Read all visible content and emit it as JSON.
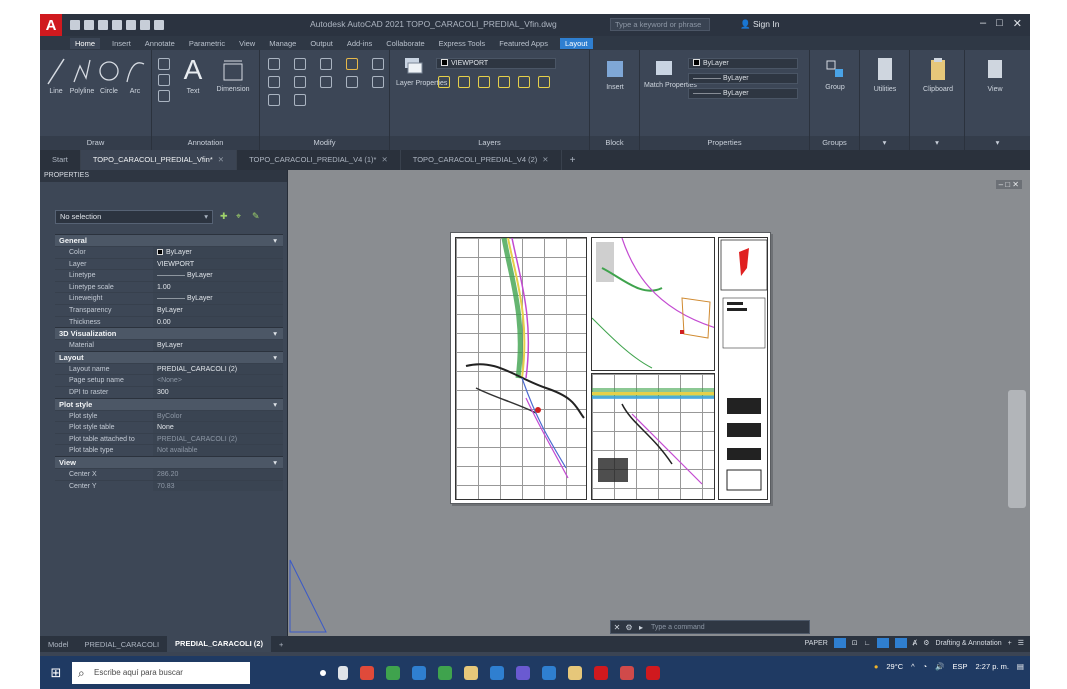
{
  "title_bar": {
    "app_letter": "A",
    "title": "Autodesk AutoCAD 2021  TOPO_CARACOLI_PREDIAL_Vfin.dwg",
    "search_placeholder": "Type a keyword or phrase",
    "signin": "Sign In"
  },
  "ribbon_tabs": [
    "Home",
    "Insert",
    "Annotate",
    "Parametric",
    "View",
    "Manage",
    "Output",
    "Add-ins",
    "Collaborate",
    "Express Tools",
    "Featured Apps",
    "Layout"
  ],
  "ribbon": {
    "draw": {
      "title": "Draw",
      "line": "Line",
      "polyline": "Polyline",
      "circle": "Circle",
      "arc": "Arc"
    },
    "annotation": {
      "title": "Annotation",
      "text": "Text",
      "dimension": "Dimension"
    },
    "modify": {
      "title": "Modify"
    },
    "layers": {
      "title": "Layers",
      "layer_properties": "Layer Properties",
      "current_layer": "VIEWPORT"
    },
    "block": {
      "title": "Block",
      "insert": "Insert"
    },
    "properties": {
      "title": "Properties",
      "match": "Match Properties",
      "bylayer_1": "ByLayer",
      "bylayer_2": "ByLayer",
      "bylayer_3": "ByLayer"
    },
    "groups": {
      "title": "Groups",
      "group": "Group"
    },
    "utilities": "Utilities",
    "clipboard": "Clipboard",
    "view": "View"
  },
  "file_tabs": [
    {
      "label": "Start",
      "active": false
    },
    {
      "label": "TOPO_CARACOLI_PREDIAL_Vfin*",
      "active": true
    },
    {
      "label": "TOPO_CARACOLI_PREDIAL_V4 (1)*",
      "active": false
    },
    {
      "label": "TOPO_CARACOLI_PREDIAL_V4 (2)",
      "active": false
    }
  ],
  "properties_palette": {
    "title": "PROPERTIES",
    "selection": "No selection",
    "sections": [
      {
        "name": "General",
        "rows": [
          {
            "k": "Color",
            "v": "ByLayer"
          },
          {
            "k": "Layer",
            "v": "VIEWPORT"
          },
          {
            "k": "Linetype",
            "v": "———— ByLayer"
          },
          {
            "k": "Linetype scale",
            "v": "1.00"
          },
          {
            "k": "Lineweight",
            "v": "———— ByLayer"
          },
          {
            "k": "Transparency",
            "v": "ByLayer"
          },
          {
            "k": "Thickness",
            "v": "0.00"
          }
        ]
      },
      {
        "name": "3D Visualization",
        "rows": [
          {
            "k": "Material",
            "v": "ByLayer"
          }
        ]
      },
      {
        "name": "Layout",
        "rows": [
          {
            "k": "Layout name",
            "v": "PREDIAL_CARACOLI (2)"
          },
          {
            "k": "Page setup name",
            "v": "<None>"
          },
          {
            "k": "DPI to raster",
            "v": "300"
          }
        ]
      },
      {
        "name": "Plot style",
        "rows": [
          {
            "k": "Plot style",
            "v": "ByColor"
          },
          {
            "k": "Plot style table",
            "v": "None"
          },
          {
            "k": "Plot table attached to",
            "v": "PREDIAL_CARACOLI (2)"
          },
          {
            "k": "Plot table type",
            "v": "Not available"
          }
        ]
      },
      {
        "name": "View",
        "rows": [
          {
            "k": "Center X",
            "v": "286.20"
          },
          {
            "k": "Center Y",
            "v": "70.83"
          }
        ]
      }
    ]
  },
  "command_line": {
    "placeholder": "Type a command"
  },
  "layout_tabs": [
    {
      "label": "Model",
      "active": false
    },
    {
      "label": "PREDIAL_CARACOLI",
      "active": false
    },
    {
      "label": "PREDIAL_CARACOLI (2)",
      "active": true
    }
  ],
  "status_bar": {
    "paper": "PAPER",
    "workspace": "Drafting & Annotation"
  },
  "taskbar": {
    "search": "Escribe aquí para buscar",
    "weather": "29°C",
    "lang": "ESP",
    "time": "2:27 p. m."
  },
  "colors": {
    "autocad_red": "#d0191e",
    "layout_blue": "#2f7fd0",
    "taskbar": "#1f3a63"
  }
}
